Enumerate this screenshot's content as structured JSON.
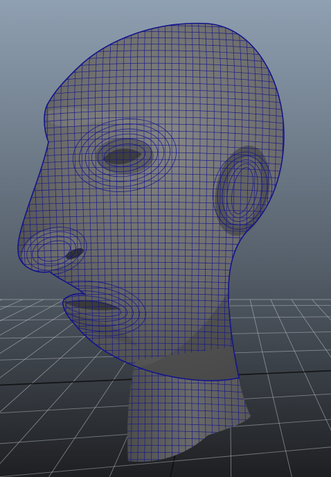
{
  "viewport": {
    "background_top": "#8fa0b2",
    "background_bottom": "#1e1f22",
    "grid_color": "#c4c8cc",
    "grid_axis_color": "#0d0d0d",
    "mesh_fill": "#6c6c6c",
    "mesh_fill_light": "#858585",
    "mesh_fill_dark": "#474747",
    "wire_color": "#12148c",
    "selection_highlight": false
  },
  "model": {
    "type": "polygon-head-mesh",
    "display_mode": "wireframe-on-shaded",
    "view": "perspective"
  }
}
